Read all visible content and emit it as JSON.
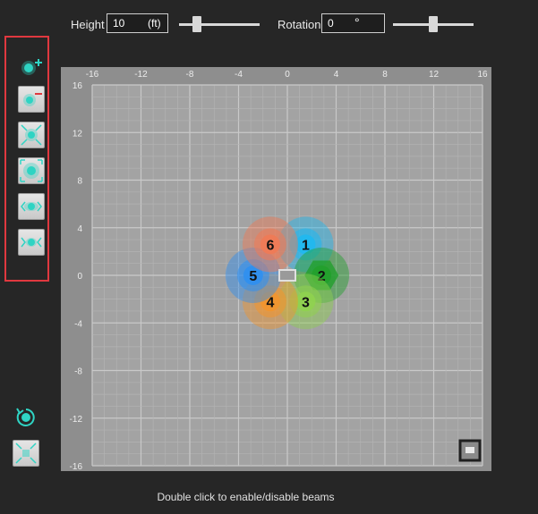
{
  "controls": {
    "height_label": "Height",
    "height_value": "10",
    "height_unit": "(ft)",
    "rotation_label": "Rotation",
    "rotation_value": "0",
    "rotation_unit": "°"
  },
  "toolbar": {
    "buttons": [
      {
        "name": "add-beam-button",
        "icon": "add-beam-icon"
      },
      {
        "name": "remove-beam-button",
        "icon": "remove-beam-icon"
      },
      {
        "name": "shrink-beams-button",
        "icon": "contract-icon"
      },
      {
        "name": "expand-beams-button",
        "icon": "expand-icon"
      },
      {
        "name": "spread-horizontal-button",
        "icon": "spread-horizontal-icon"
      },
      {
        "name": "narrow-horizontal-button",
        "icon": "narrow-horizontal-icon"
      }
    ],
    "bottom_buttons": [
      {
        "name": "reset-rotation-button",
        "icon": "rotate-reset-icon"
      },
      {
        "name": "fit-view-button",
        "icon": "fit-view-icon"
      }
    ]
  },
  "grid": {
    "x_ticks": [
      "-16",
      "-12",
      "-8",
      "-4",
      "0",
      "4",
      "8",
      "12",
      "16"
    ],
    "y_ticks": [
      "16",
      "12",
      "8",
      "4",
      "0",
      "-4",
      "-8",
      "-12",
      "-16"
    ],
    "range": [
      -16,
      16
    ]
  },
  "beams": [
    {
      "label": "1",
      "x": 1.5,
      "y": 2.6,
      "color": "#1fb8f0"
    },
    {
      "label": "2",
      "x": 2.8,
      "y": 0,
      "color": "#22a02c"
    },
    {
      "label": "3",
      "x": 1.5,
      "y": -2.2,
      "color": "#8fd14f"
    },
    {
      "label": "4",
      "x": -1.4,
      "y": -2.2,
      "color": "#f2952d"
    },
    {
      "label": "5",
      "x": -2.8,
      "y": 0,
      "color": "#2f8ff0"
    },
    {
      "label": "6",
      "x": -1.4,
      "y": 2.6,
      "color": "#f07a55"
    }
  ],
  "status": {
    "message": "Double click to enable/disable beams"
  }
}
